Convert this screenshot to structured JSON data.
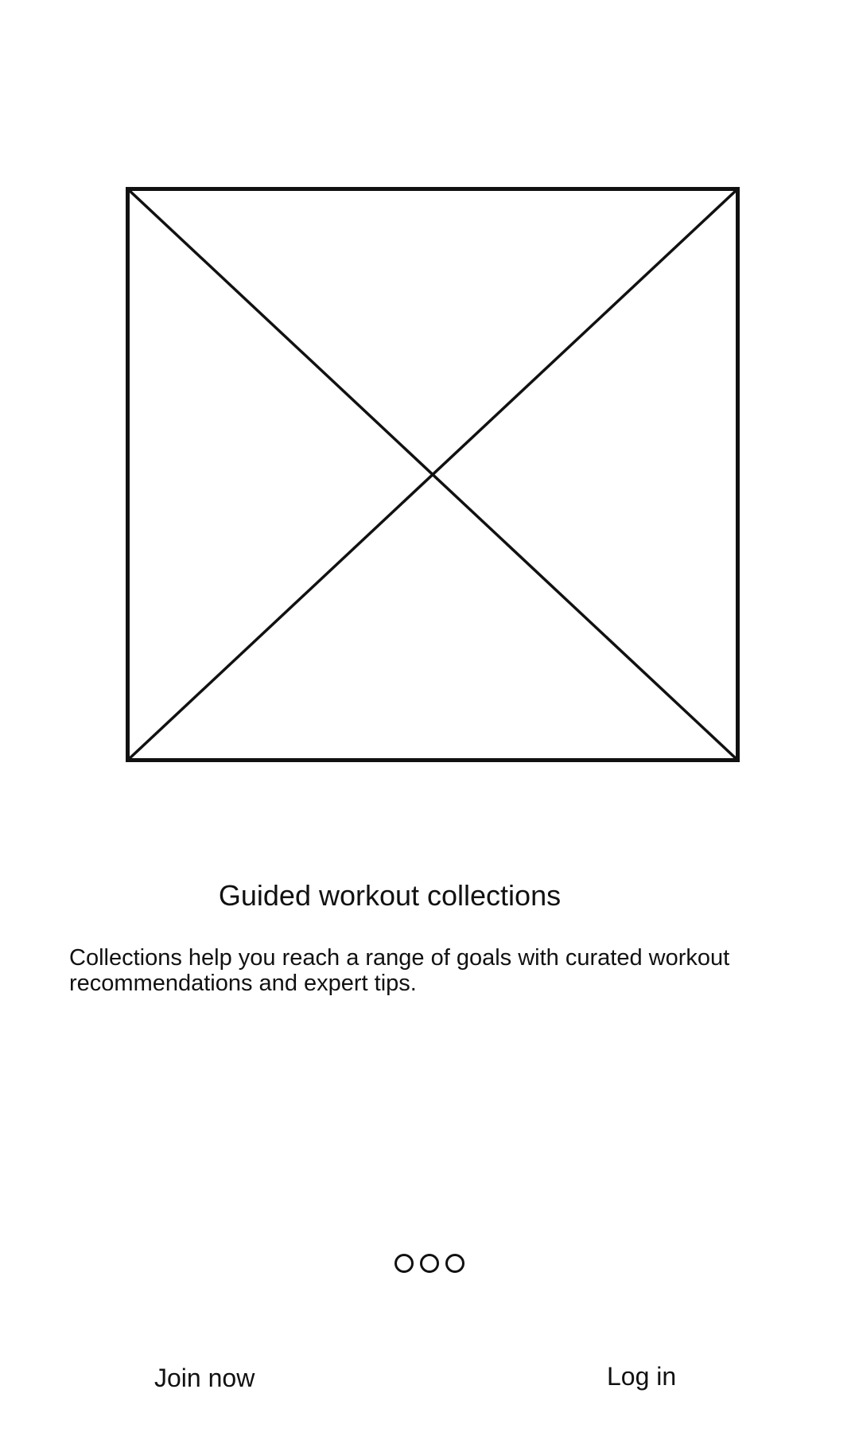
{
  "onboarding": {
    "image": {
      "icon": "image-placeholder-icon"
    },
    "title": "Guided workout collections",
    "description": "Collections help you reach a range of goals with curated workout recommendations and expert tips.",
    "pager": {
      "total_pages": 3
    }
  },
  "actions": {
    "join_label": "Join now",
    "login_label": "Log in"
  }
}
